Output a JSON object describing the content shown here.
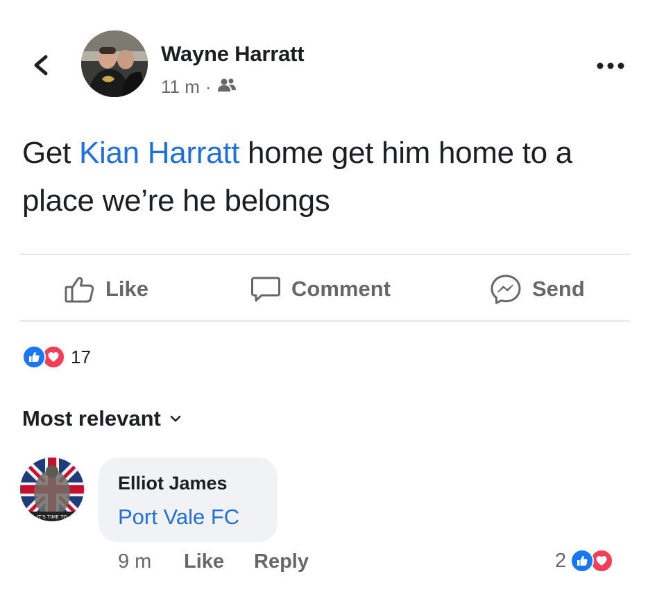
{
  "post": {
    "author": "Wayne Harratt",
    "time": "11 m",
    "separator": "·",
    "audience_icon": "friends-icon",
    "text_before": "Get ",
    "mention": "Kian Harratt",
    "text_after": " home get him home to a place we’re he belongs"
  },
  "actions": {
    "like": "Like",
    "comment": "Comment",
    "send": "Send"
  },
  "reactions": {
    "count": "17",
    "types": [
      "like",
      "love"
    ]
  },
  "comments_section": {
    "sort_label": "Most relevant"
  },
  "comment": {
    "author": "Elliot James",
    "text": "Port Vale FC",
    "time": "9 m",
    "like_label": "Like",
    "reply_label": "Reply",
    "reaction_count": "2",
    "avatar_caption": "IT'S TIME TO"
  },
  "colors": {
    "link": "#216fdb",
    "like_blue": "#1877f2",
    "love_red": "#f33e58",
    "secondary_text": "#65676b",
    "bubble_bg": "#f0f2f5"
  }
}
